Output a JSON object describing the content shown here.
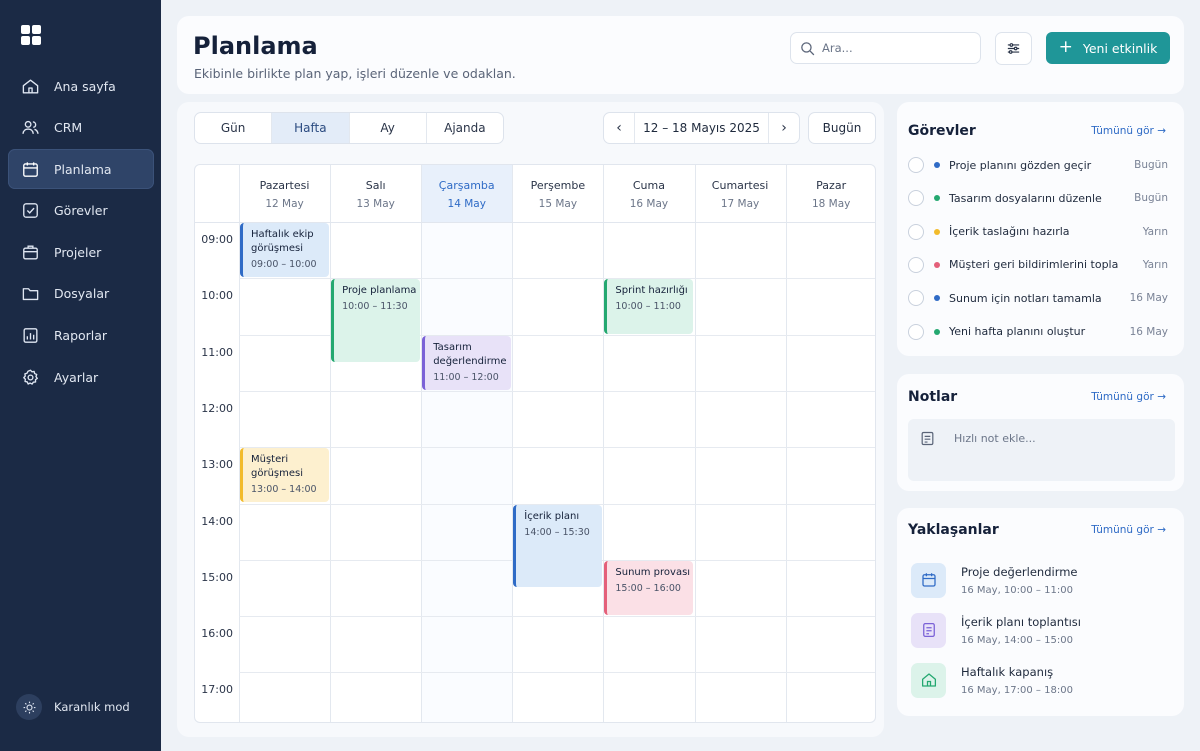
{
  "sidebar": {
    "items": [
      {
        "label": "Ana sayfa",
        "icon": "home-icon"
      },
      {
        "label": "CRM",
        "icon": "users-icon"
      },
      {
        "label": "Planlama",
        "icon": "calendar-icon",
        "active": true
      },
      {
        "label": "Görevler",
        "icon": "check-square-icon"
      },
      {
        "label": "Projeler",
        "icon": "briefcase-icon"
      },
      {
        "label": "Dosyalar",
        "icon": "folder-icon"
      },
      {
        "label": "Raporlar",
        "icon": "report-icon"
      },
      {
        "label": "Ayarlar",
        "icon": "gear-icon"
      }
    ],
    "dark_mode_label": "Karanlık mod"
  },
  "header": {
    "title": "Planlama",
    "subtitle": "Ekibinle birlikte plan yap, işleri düzenle ve odaklan.",
    "search_placeholder": "Ara...",
    "new_event_label": "Yeni etkinlik"
  },
  "views": {
    "tabs": [
      "Gün",
      "Hafta",
      "Ay",
      "Ajanda"
    ],
    "active": "Hafta",
    "date_range": "12 – 18 Mayıs 2025",
    "today_label": "Bugün"
  },
  "calendar": {
    "days": [
      {
        "name": "Pazartesi",
        "date": "12 May"
      },
      {
        "name": "Salı",
        "date": "13 May"
      },
      {
        "name": "Çarşamba",
        "date": "14 May",
        "today": true
      },
      {
        "name": "Perşembe",
        "date": "15 May"
      },
      {
        "name": "Cuma",
        "date": "16 May"
      },
      {
        "name": "Cumartesi",
        "date": "17 May"
      },
      {
        "name": "Pazar",
        "date": "18 May"
      }
    ],
    "hours": [
      "09:00",
      "10:00",
      "11:00",
      "12:00",
      "13:00",
      "14:00",
      "15:00",
      "16:00",
      "17:00"
    ],
    "events": [
      {
        "title": "Haftalık ekip görüşmesi",
        "time": "09:00 – 10:00",
        "day": 0,
        "start": 9,
        "end": 10,
        "color": "blue"
      },
      {
        "title": "Proje planlama",
        "time": "10:00 – 11:30",
        "day": 1,
        "start": 10,
        "end": 11.5,
        "color": "green"
      },
      {
        "title": "Tasarım değerlendirme",
        "time": "11:00 – 12:00",
        "day": 2,
        "start": 11,
        "end": 12,
        "color": "purple"
      },
      {
        "title": "Sprint hazırlığı",
        "time": "10:00 – 11:00",
        "day": 4,
        "start": 10,
        "end": 11,
        "color": "green"
      },
      {
        "title": "Müşteri görüşmesi",
        "time": "13:00 – 14:00",
        "day": 0,
        "start": 13,
        "end": 14,
        "color": "yellow"
      },
      {
        "title": "İçerik planı",
        "time": "14:00 – 15:30",
        "day": 3,
        "start": 14,
        "end": 15.5,
        "color": "blue"
      },
      {
        "title": "Sunum provası",
        "time": "15:00 – 16:00",
        "day": 4,
        "start": 15,
        "end": 16,
        "color": "pink"
      }
    ]
  },
  "tasks": {
    "title": "Görevler",
    "see_all": "Tümünü gör",
    "items": [
      {
        "text": "Proje planını gözden geçir",
        "due": "Bugün",
        "color": "#2f6bc6"
      },
      {
        "text": "Tasarım dosyalarını düzenle",
        "due": "Bugün",
        "color": "#24a870"
      },
      {
        "text": "İçerik taslağını hazırla",
        "due": "Yarın",
        "color": "#f2bb2b"
      },
      {
        "text": "Müşteri geri bildirimlerini topla",
        "due": "Yarın",
        "color": "#e4607a"
      },
      {
        "text": "Sunum için notları tamamla",
        "due": "16 May",
        "color": "#2f6bc6"
      },
      {
        "text": "Yeni hafta planını oluştur",
        "due": "16 May",
        "color": "#24a870"
      }
    ]
  },
  "notes": {
    "title": "Notlar",
    "see_all": "Tümünü gör",
    "placeholder": "Hızlı not ekle..."
  },
  "upcoming": {
    "title": "Yaklaşanlar",
    "see_all": "Tümünü gör",
    "items": [
      {
        "title": "Proje değerlendirme",
        "time": "16 May, 10:00 – 11:00",
        "icon": "calendar-icon",
        "bg": "#dceaf9",
        "fg": "#2f6bc6"
      },
      {
        "title": "İçerik planı toplantısı",
        "time": "16 May, 14:00 – 15:00",
        "icon": "document-icon",
        "bg": "#e8e2f8",
        "fg": "#7b62d7"
      },
      {
        "title": "Haftalık kapanış",
        "time": "16 May, 17:00 – 18:00",
        "icon": "home-icon",
        "bg": "#dcf3ea",
        "fg": "#24a870"
      }
    ]
  }
}
